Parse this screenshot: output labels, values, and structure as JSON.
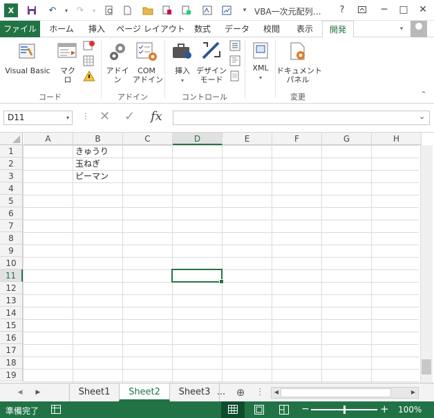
{
  "app": {
    "title": "VBA一次元配列…"
  },
  "window": {
    "help": "?",
    "minimize": "─",
    "restore": "□",
    "close": "✕"
  },
  "tabs": [
    "ファイル",
    "ホーム",
    "挿入",
    "ページ レイアウト",
    "数式",
    "データ",
    "校閲",
    "表示",
    "開発"
  ],
  "ribbon": {
    "groups": [
      {
        "label": "コード",
        "items": [
          "Visual Basic",
          "マクロ"
        ]
      },
      {
        "label": "アドイン",
        "items": [
          "アドイン",
          "COM\nアドイン"
        ]
      },
      {
        "label": "コントロール",
        "items": [
          "挿入",
          "デザイン\nモード"
        ]
      },
      {
        "label": "",
        "items": [
          "XML"
        ]
      },
      {
        "label": "変更",
        "items": [
          "ドキュメント\nパネル"
        ]
      }
    ]
  },
  "formula": {
    "name_box": "D11",
    "fx": "fx",
    "value": ""
  },
  "columns": [
    "A",
    "B",
    "C",
    "D",
    "E",
    "F",
    "G",
    "H"
  ],
  "rows": [
    "1",
    "2",
    "3",
    "4",
    "5",
    "6",
    "7",
    "8",
    "9",
    "10",
    "11",
    "12",
    "13",
    "14",
    "15",
    "16",
    "17",
    "18",
    "19"
  ],
  "cells": [
    {
      "ref": "B1",
      "value": "きゅうり"
    },
    {
      "ref": "B2",
      "value": "玉ねぎ"
    },
    {
      "ref": "B3",
      "value": "ピーマン"
    }
  ],
  "selected_cell": "D11",
  "sheets": {
    "tabs": [
      "Sheet1",
      "Sheet2",
      "Sheet3"
    ],
    "active": "Sheet2",
    "more": "..."
  },
  "status": {
    "mode": "準備完了",
    "zoom": "100%",
    "zoom_fraction": 0.5
  },
  "colors": {
    "accent": "#217346"
  }
}
